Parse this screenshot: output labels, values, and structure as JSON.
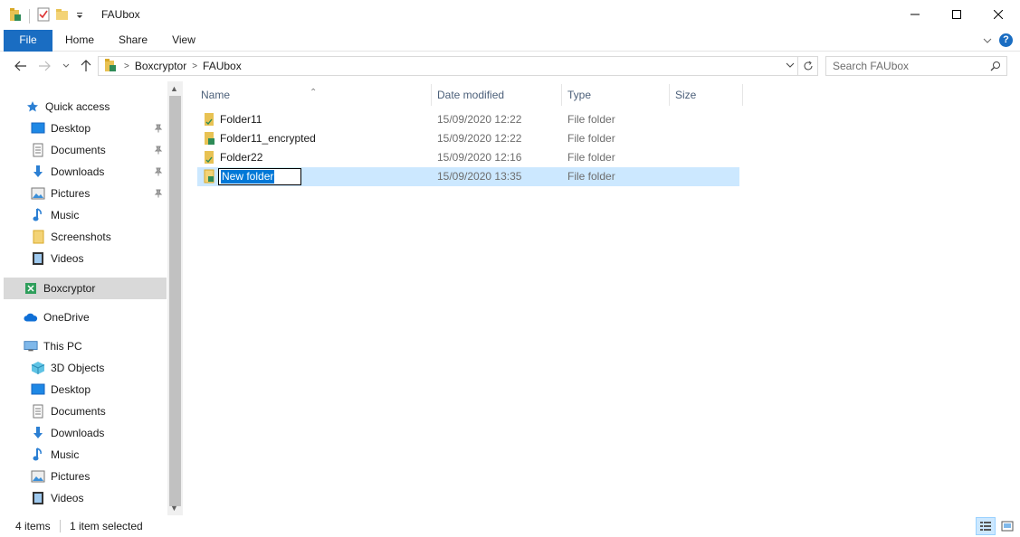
{
  "window": {
    "title": "FAUbox"
  },
  "ribbon": {
    "tabs": [
      "File",
      "Home",
      "Share",
      "View"
    ]
  },
  "address": {
    "crumbs": [
      "Boxcryptor",
      "FAUbox"
    ]
  },
  "search": {
    "placeholder": "Search FAUbox"
  },
  "sidebar": {
    "items": [
      {
        "label": "Quick access",
        "icon": "star-icon",
        "pinned": false
      },
      {
        "label": "Desktop",
        "icon": "desktop-icon",
        "pinned": true
      },
      {
        "label": "Documents",
        "icon": "documents-icon",
        "pinned": true
      },
      {
        "label": "Downloads",
        "icon": "downloads-icon",
        "pinned": true
      },
      {
        "label": "Pictures",
        "icon": "pictures-icon",
        "pinned": true
      },
      {
        "label": "Music",
        "icon": "music-icon",
        "pinned": false
      },
      {
        "label": "Screenshots",
        "icon": "folder-icon",
        "pinned": false
      },
      {
        "label": "Videos",
        "icon": "videos-icon",
        "pinned": false
      },
      {
        "label": "Boxcryptor",
        "icon": "boxcryptor-icon",
        "pinned": false
      },
      {
        "label": "OneDrive",
        "icon": "onedrive-icon",
        "pinned": false
      },
      {
        "label": "This PC",
        "icon": "this-pc-icon",
        "pinned": false
      },
      {
        "label": "3D Objects",
        "icon": "3d-objects-icon",
        "pinned": false
      },
      {
        "label": "Desktop",
        "icon": "desktop-icon",
        "pinned": false
      },
      {
        "label": "Documents",
        "icon": "documents-icon",
        "pinned": false
      },
      {
        "label": "Downloads",
        "icon": "downloads-icon",
        "pinned": false
      },
      {
        "label": "Music",
        "icon": "music-icon",
        "pinned": false
      },
      {
        "label": "Pictures",
        "icon": "pictures-icon",
        "pinned": false
      },
      {
        "label": "Videos",
        "icon": "videos-icon",
        "pinned": false
      }
    ]
  },
  "columns": {
    "name": "Name",
    "date": "Date modified",
    "type": "Type",
    "size": "Size"
  },
  "files": [
    {
      "name": "Folder11",
      "date": "15/09/2020 12:22",
      "type": "File folder"
    },
    {
      "name": "Folder11_encrypted",
      "date": "15/09/2020 12:22",
      "type": "File folder"
    },
    {
      "name": "Folder22",
      "date": "15/09/2020 12:16",
      "type": "File folder"
    },
    {
      "name": "New folder",
      "date": "15/09/2020 13:35",
      "type": "File folder"
    }
  ],
  "status": {
    "count": "4 items",
    "selected": "1 item selected"
  },
  "colors": {
    "accent": "#1a6dc2",
    "selection": "#cce8ff",
    "folder": "#e8c253",
    "header_text": "#4c607a"
  }
}
